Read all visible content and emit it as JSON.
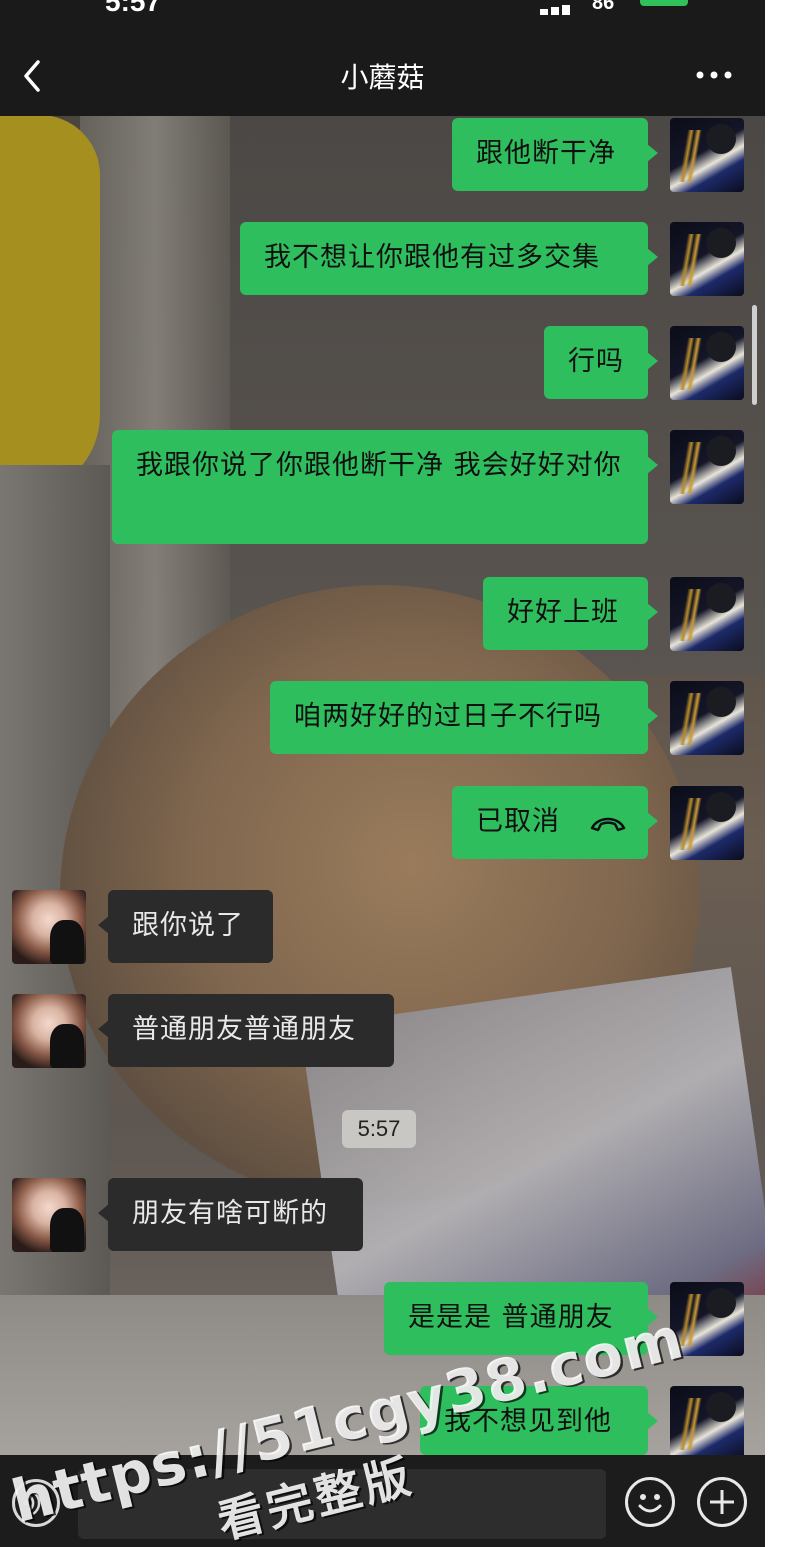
{
  "status_bar": {
    "time": "5:57",
    "battery": "86"
  },
  "nav": {
    "title": "小蘑菇",
    "back_icon": "chevron-left-icon",
    "more_icon": "more-dots-icon"
  },
  "messages": [
    {
      "from": "me",
      "text": "跟他断干净"
    },
    {
      "from": "me",
      "text": "我不想让你跟他有过多交集"
    },
    {
      "from": "me",
      "text": "行吗"
    },
    {
      "from": "me",
      "text": "我跟你说了你跟他断干净 我会好好对你"
    },
    {
      "from": "me",
      "text": "好好上班"
    },
    {
      "from": "me",
      "text": "咱两好好的过日子不行吗"
    },
    {
      "from": "me",
      "text": "已取消",
      "type": "call",
      "icon": "phone-hangup-icon"
    },
    {
      "from": "her",
      "text": "跟你说了"
    },
    {
      "from": "her",
      "text": "普通朋友普通朋友"
    },
    {
      "from": "system",
      "text": "5:57",
      "type": "timestamp"
    },
    {
      "from": "her",
      "text": "朋友有啥可断的"
    },
    {
      "from": "me",
      "text": "是是是 普通朋友"
    },
    {
      "from": "me",
      "text": "我不想见到他"
    }
  ],
  "input_bar": {
    "voice_icon": "voice-icon",
    "emoji_icon": "emoji-icon",
    "plus_icon": "plus-icon"
  },
  "watermark": {
    "url": "https://51cgy38.com",
    "subtitle": "看完整版"
  },
  "colors": {
    "bubble_me": "#2fbe5e",
    "bubble_her": "#2b2b2b",
    "bar": "#1a1a1a"
  }
}
